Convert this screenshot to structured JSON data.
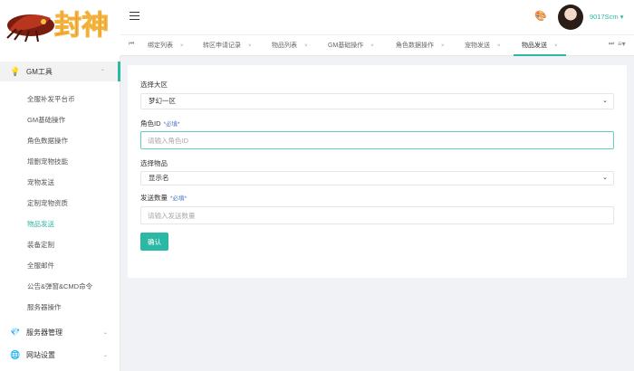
{
  "logo": {
    "text": "封神"
  },
  "header": {
    "username": "9017Scm ▾"
  },
  "tabs": {
    "items": [
      {
        "label": "绑定列表",
        "active": false
      },
      {
        "label": "转区申请记录",
        "active": false
      },
      {
        "label": "物品列表",
        "active": false
      },
      {
        "label": "GM基础操作",
        "active": false
      },
      {
        "label": "角色数据操作",
        "active": false
      },
      {
        "label": "宠物发送",
        "active": false
      },
      {
        "label": "物品发送",
        "active": true
      }
    ],
    "close_glyph": "×"
  },
  "sidebar": {
    "groups": [
      {
        "label": "GM工具",
        "icon": "bulb-icon",
        "expanded": true
      },
      {
        "label": "服务器管理",
        "icon": "diamond-icon",
        "expanded": false
      },
      {
        "label": "网站设置",
        "icon": "globe-icon",
        "expanded": false
      }
    ],
    "items": [
      {
        "label": "全服补发平台币",
        "active": false
      },
      {
        "label": "GM基础操作",
        "active": false
      },
      {
        "label": "角色数据操作",
        "active": false
      },
      {
        "label": "增删宠物技能",
        "active": false
      },
      {
        "label": "宠物发送",
        "active": false
      },
      {
        "label": "定制宠物资质",
        "active": false
      },
      {
        "label": "物品发送",
        "active": true
      },
      {
        "label": "装备定制",
        "active": false
      },
      {
        "label": "全服邮件",
        "active": false
      },
      {
        "label": "公告&弹窗&CMD命令",
        "active": false
      },
      {
        "label": "服务器操作",
        "active": false
      }
    ]
  },
  "form": {
    "zone": {
      "label": "选择大区",
      "value": "梦幻一区"
    },
    "role": {
      "label": "角色ID",
      "required": "*必填*",
      "placeholder": "请输入角色ID"
    },
    "item": {
      "label": "选择物品",
      "value": "显示名"
    },
    "qty": {
      "label": "发送数量",
      "required": "*必填*",
      "placeholder": "请输入发送数量"
    },
    "submit_label": "确认"
  },
  "colors": {
    "accent": "#2bb8a4",
    "required": "#4a74c9"
  }
}
